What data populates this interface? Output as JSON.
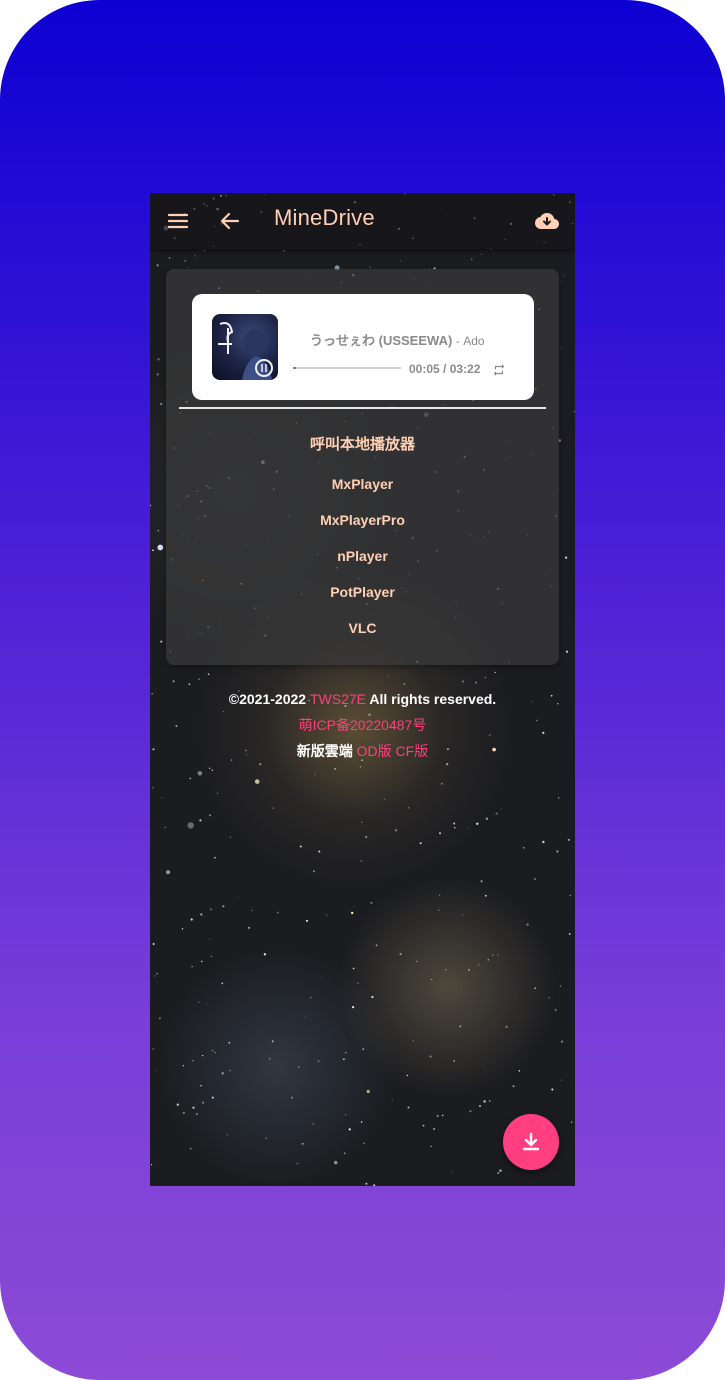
{
  "app": {
    "title": "MineDrive",
    "accent": "#ffd0b5",
    "link_color": "#ff3f7f",
    "fab_color": "#ff3f7f"
  },
  "appbar": {
    "icons": [
      "menu-icon",
      "back-arrow-icon",
      "cloud-download-icon"
    ]
  },
  "player": {
    "song_title": "うっせぇわ (USSEEWA)",
    "artist": "- Ado",
    "time": "00:05 / 03:22",
    "progress_fraction": 0.025,
    "repeat_icon": "repeat-icon"
  },
  "local_players": {
    "heading": "呼叫本地播放器",
    "items": [
      "MxPlayer",
      "MxPlayerPro",
      "nPlayer",
      "PotPlayer",
      "VLC"
    ]
  },
  "footer": {
    "copyright_prefix": "©2021-2022",
    "author": "TWS27E",
    "copyright_suffix": "All rights reserved.",
    "icp": "萌ICP备20220487号",
    "new_version_label": "新版雲端",
    "od_link": "OD版",
    "cf_link": "CF版"
  },
  "fab": {
    "icon": "download-icon"
  }
}
